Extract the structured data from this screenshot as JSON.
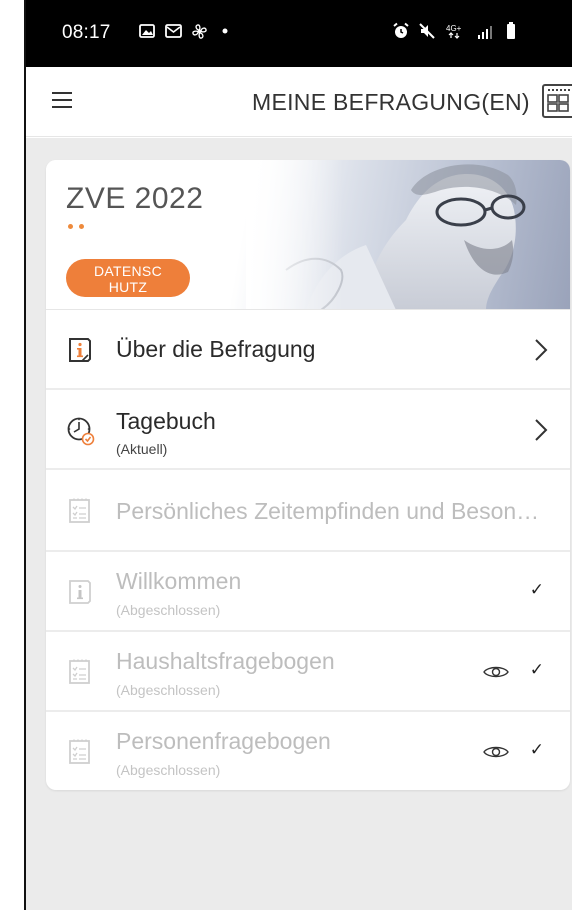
{
  "status_bar": {
    "time": "08:17",
    "left_icons": [
      "gallery-icon",
      "mail-icon",
      "fan-icon",
      "dot-icon"
    ],
    "right_icons": [
      "alarm-icon",
      "mute-icon",
      "4g-icon",
      "signal-icon",
      "battery-icon"
    ],
    "network_label": "4G+"
  },
  "app_bar": {
    "title": "MEINE BEFRAGUNG(EN)"
  },
  "survey": {
    "title": "ZVE 2022",
    "privacy_badge_line1": "DATENSC",
    "privacy_badge_line2": "HUTZ",
    "accent_color": "#ee7f3a"
  },
  "rows": [
    {
      "title": "Über die Befragung",
      "subtitle": "",
      "state": "active",
      "icon": "info-icon"
    },
    {
      "title": "Tagebuch",
      "subtitle": "(Aktuell)",
      "state": "active",
      "icon": "clock-icon"
    },
    {
      "title": "Persönliches Zeitempfinden und Beson…",
      "subtitle": "",
      "state": "disabled",
      "icon": "checklist-icon"
    },
    {
      "title": "Willkommen",
      "subtitle": "(Abgeschlossen)",
      "state": "done",
      "icon": "info-icon"
    },
    {
      "title": "Haushaltsfragebogen",
      "subtitle": "(Abgeschlossen)",
      "state": "done",
      "icon": "checklist-icon",
      "viewable": true
    },
    {
      "title": "Personenfragebogen",
      "subtitle": "(Abgeschlossen)",
      "state": "done",
      "icon": "checklist-icon",
      "viewable": true
    }
  ],
  "marks": {
    "check": "✓"
  }
}
